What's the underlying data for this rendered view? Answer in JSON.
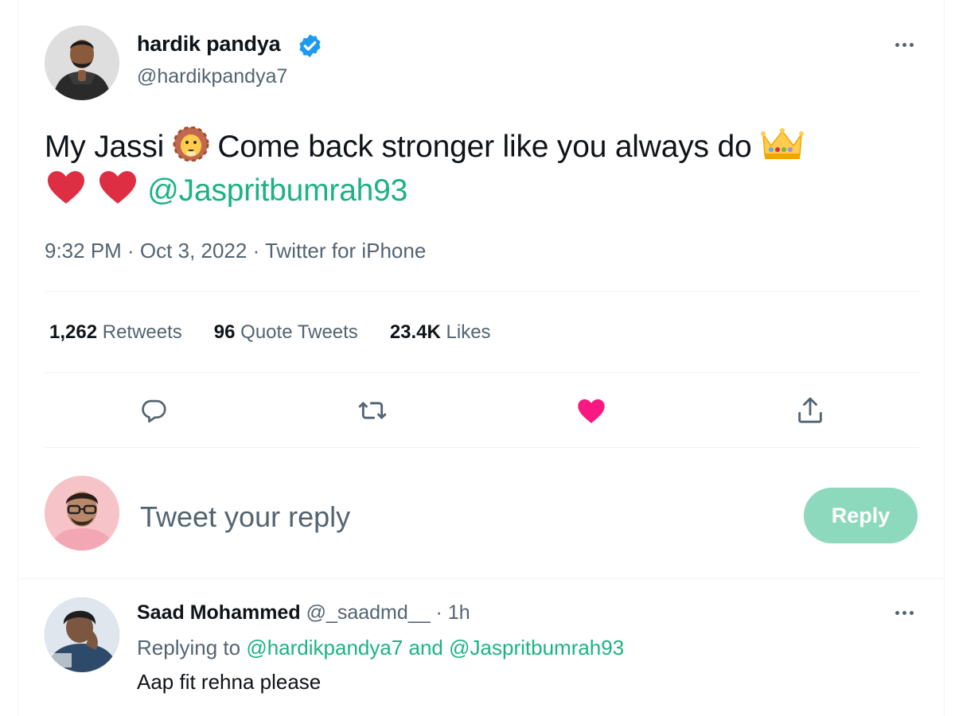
{
  "tweet": {
    "author": {
      "name": "hardik pandya",
      "handle": "@hardikpandya7",
      "verified": true
    },
    "text_part1": "My Jassi",
    "text_part2": "Come back stronger like you always do",
    "mention": "@Jaspritbumrah93",
    "meta": "9:32 PM · Oct 3, 2022 · Twitter for iPhone",
    "stats": {
      "retweets_count": "1,262",
      "retweets_label": "Retweets",
      "quotes_count": "96",
      "quotes_label": "Quote Tweets",
      "likes_count": "23.4K",
      "likes_label": "Likes"
    },
    "liked": true
  },
  "composer": {
    "placeholder": "Tweet your reply",
    "button_label": "Reply"
  },
  "reply": {
    "name": "Saad Mohammed",
    "handle": "@_saadmd__",
    "time": "· 1h",
    "replying_prefix": "Replying to",
    "replying_user1": "@hardikpandya7",
    "replying_and": "and",
    "replying_user2": "@Jaspritbumrah93",
    "text": "Aap fit rehna please"
  },
  "colors": {
    "accent": "#1bb37f",
    "like": "#f91880",
    "verified": "#1d9bf0",
    "muted_text": "#536471",
    "reply_button": "#8cd9bd"
  },
  "icons": [
    "verified-badge-icon",
    "more-icon",
    "reply-icon",
    "retweet-icon",
    "like-icon",
    "share-icon",
    "lion-emoji",
    "crown-emoji",
    "heart-emoji"
  ]
}
